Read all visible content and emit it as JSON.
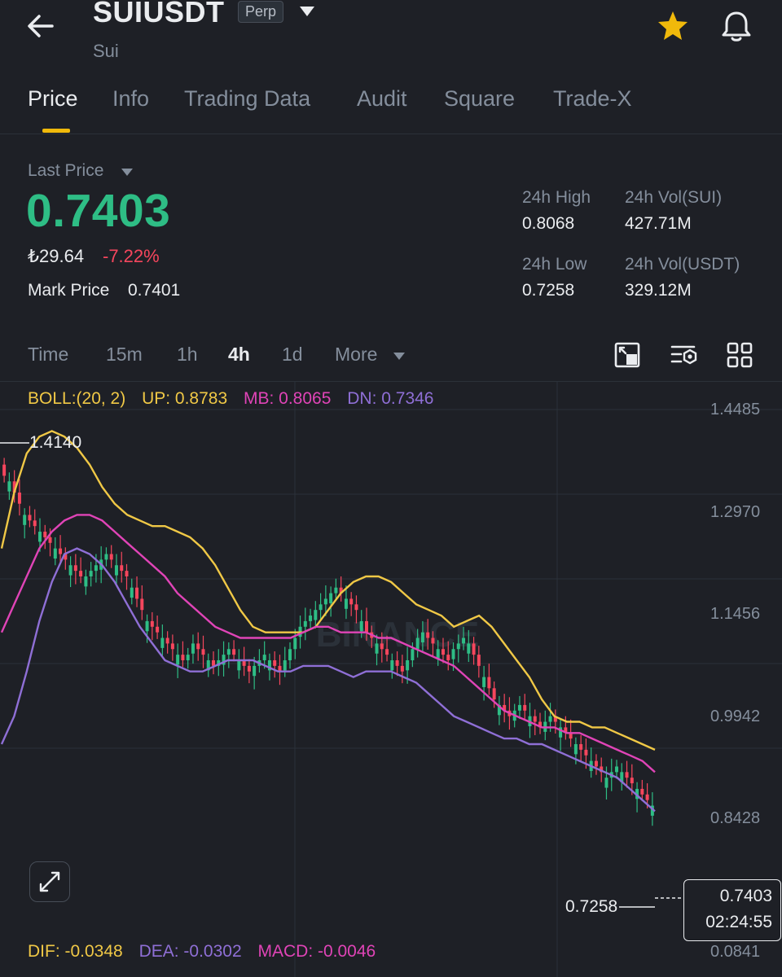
{
  "header": {
    "symbol": "SUIUSDT",
    "badge": "Perp",
    "name": "Sui",
    "icons": [
      "back-arrow-icon",
      "caret-down-icon",
      "star-icon",
      "bell-icon"
    ]
  },
  "tabs": [
    {
      "label": "Price",
      "active": true
    },
    {
      "label": "Info"
    },
    {
      "label": "Trading Data"
    },
    {
      "label": "Audit"
    },
    {
      "label": "Square"
    },
    {
      "label": "Trade-X"
    }
  ],
  "price": {
    "last_price_label": "Last Price",
    "last_price": "0.7403",
    "fiat_price": "₺29.64",
    "change_pct": "-7.22%",
    "mark_price_label": "Mark Price",
    "mark_price": "0.7401"
  },
  "stats": {
    "high_label": "24h High",
    "high": "0.8068",
    "low_label": "24h Low",
    "low": "0.7258",
    "vol_sui_label": "24h Vol(SUI)",
    "vol_sui": "427.71M",
    "vol_usdt_label": "24h Vol(USDT)",
    "vol_usdt": "329.12M"
  },
  "intervals": [
    {
      "label": "Time"
    },
    {
      "label": "15m"
    },
    {
      "label": "1h"
    },
    {
      "label": "4h",
      "active": true
    },
    {
      "label": "1d"
    },
    {
      "label": "More"
    }
  ],
  "chart_tools": [
    "chart-swap-icon",
    "indicator-settings-icon",
    "grid-layout-icon"
  ],
  "boll": {
    "label": "BOLL:(20, 2)",
    "up": "UP: 0.8783",
    "mb": "MB: 0.8065",
    "dn": "DN: 0.7346"
  },
  "colors": {
    "up": "#2ebd85",
    "down": "#f6465d",
    "accent": "#f0b90b",
    "boll_up": "#f0c846",
    "boll_mb": "#e044b7",
    "boll_dn": "#8f6fd6"
  },
  "watermark": "BINANCE",
  "chart_data": {
    "type": "candlestick",
    "y_ticks": [
      "1.4485",
      "1.2970",
      "1.1456",
      "0.9942",
      "0.8428"
    ],
    "ylim": [
      0.7,
      1.4485
    ],
    "high_marker": "1.4140",
    "low_marker": "0.7258",
    "current_price": "0.7403",
    "countdown": "02:24:55",
    "close": [
      1.33,
      1.32,
      1.3,
      1.28,
      1.26,
      1.25,
      1.24,
      1.23,
      1.22,
      1.21,
      1.2,
      1.19,
      1.18,
      1.17,
      1.16,
      1.15,
      1.15,
      1.16,
      1.17,
      1.18,
      1.19,
      1.18,
      1.17,
      1.16,
      1.15,
      1.13,
      1.11,
      1.09,
      1.07,
      1.06,
      1.05,
      1.04,
      1.03,
      1.02,
      1.01,
      1.0,
      1.01,
      1.03,
      1.02,
      1.01,
      1.0,
      0.99,
      1.0,
      1.01,
      1.02,
      1.01,
      1.0,
      0.99,
      0.98,
      0.99,
      1.0,
      1.01,
      1.0,
      0.99,
      0.98,
      1.0,
      1.02,
      1.04,
      1.06,
      1.07,
      1.08,
      1.09,
      1.1,
      1.11,
      1.12,
      1.13,
      1.12,
      1.11,
      1.1,
      1.09,
      1.07,
      1.05,
      1.04,
      1.03,
      1.02,
      1.01,
      1.0,
      0.99,
      0.98,
      1.0,
      1.02,
      1.04,
      1.05,
      1.04,
      1.03,
      1.02,
      1.01,
      1.0,
      1.02,
      1.03,
      1.04,
      1.03,
      1.01,
      0.99,
      0.97,
      0.95,
      0.93,
      0.92,
      0.91,
      0.9,
      0.91,
      0.92,
      0.91,
      0.9,
      0.89,
      0.88,
      0.89,
      0.9,
      0.89,
      0.88,
      0.87,
      0.86,
      0.85,
      0.84,
      0.83,
      0.82,
      0.81,
      0.8,
      0.79,
      0.8,
      0.81,
      0.8,
      0.79,
      0.78,
      0.77,
      0.76,
      0.75,
      0.74
    ],
    "boll_up": [
      1.2,
      1.3,
      1.37,
      1.4,
      1.41,
      1.4,
      1.38,
      1.35,
      1.31,
      1.28,
      1.26,
      1.25,
      1.24,
      1.24,
      1.23,
      1.22,
      1.2,
      1.17,
      1.13,
      1.09,
      1.06,
      1.05,
      1.05,
      1.05,
      1.05,
      1.06,
      1.09,
      1.12,
      1.14,
      1.15,
      1.15,
      1.14,
      1.12,
      1.1,
      1.09,
      1.08,
      1.06,
      1.07,
      1.08,
      1.06,
      1.03,
      1.0,
      0.97,
      0.93,
      0.9,
      0.89,
      0.89,
      0.88,
      0.88,
      0.87,
      0.86,
      0.85,
      0.84
    ],
    "boll_mb": [
      1.05,
      1.1,
      1.15,
      1.2,
      1.23,
      1.25,
      1.26,
      1.26,
      1.25,
      1.23,
      1.21,
      1.19,
      1.17,
      1.15,
      1.12,
      1.1,
      1.08,
      1.06,
      1.05,
      1.04,
      1.04,
      1.04,
      1.04,
      1.04,
      1.05,
      1.06,
      1.06,
      1.05,
      1.05,
      1.05,
      1.04,
      1.04,
      1.03,
      1.02,
      1.01,
      1.0,
      0.99,
      0.97,
      0.95,
      0.93,
      0.91,
      0.9,
      0.89,
      0.88,
      0.88,
      0.87,
      0.87,
      0.86,
      0.85,
      0.84,
      0.83,
      0.82,
      0.8
    ],
    "boll_dn": [
      0.85,
      0.9,
      0.98,
      1.07,
      1.14,
      1.19,
      1.2,
      1.19,
      1.17,
      1.14,
      1.1,
      1.06,
      1.03,
      1.0,
      0.99,
      0.98,
      0.98,
      0.99,
      1.0,
      1.0,
      1.0,
      0.99,
      0.98,
      0.98,
      0.99,
      0.99,
      0.99,
      0.98,
      0.97,
      0.98,
      0.98,
      0.98,
      0.97,
      0.96,
      0.94,
      0.92,
      0.9,
      0.89,
      0.88,
      0.87,
      0.86,
      0.86,
      0.85,
      0.85,
      0.84,
      0.83,
      0.82,
      0.81,
      0.8,
      0.79,
      0.77,
      0.75,
      0.73
    ]
  },
  "macd": {
    "dif": "DIF: -0.0348",
    "dea": "DEA: -0.0302",
    "macd": "MACD: -0.0046",
    "y_tick": "0.0841"
  }
}
